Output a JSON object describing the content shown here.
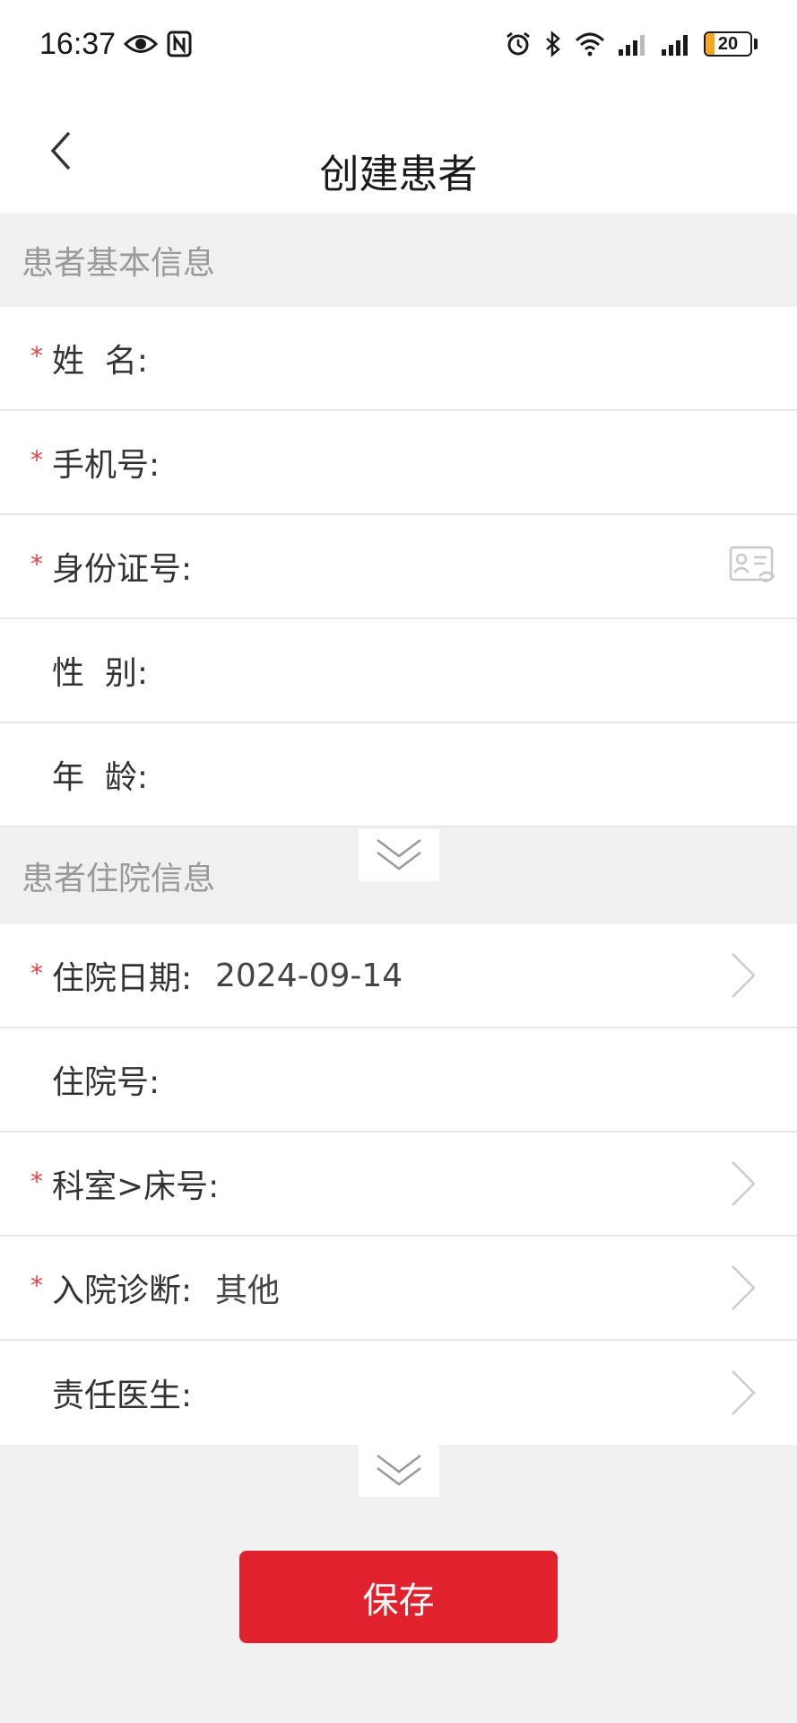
{
  "status_bar": {
    "time": "16:37",
    "battery_level": "20",
    "icons": [
      "eye-icon",
      "nfc-icon",
      "alarm-icon",
      "bluetooth-icon",
      "wifi-icon",
      "signal-icon",
      "signal-icon",
      "battery-icon"
    ]
  },
  "nav": {
    "title": "创建患者",
    "back_icon": "chevron-left-icon"
  },
  "sections": {
    "basic": {
      "title": "患者基本信息",
      "fields": {
        "name": {
          "label": "姓  名:",
          "required_mark": "*",
          "value": ""
        },
        "phone": {
          "label": "手机号:",
          "required_mark": "*",
          "value": ""
        },
        "id_number": {
          "label": "身份证号:",
          "required_mark": "*",
          "value": "",
          "icon": "id-card-scan-icon"
        },
        "gender": {
          "label": "性  别:",
          "value": ""
        },
        "age": {
          "label": "年  龄:",
          "value": ""
        }
      }
    },
    "hospital": {
      "title": "患者住院信息",
      "fields": {
        "admission_date": {
          "label": "住院日期:",
          "required_mark": "*",
          "value": "2024-09-14"
        },
        "admission_no": {
          "label": "住院号:",
          "value": ""
        },
        "dept_bed": {
          "label": "科室>床号:",
          "required_mark": "*",
          "value": ""
        },
        "diagnosis": {
          "label": "入院诊断:",
          "required_mark": "*",
          "value": "其他"
        },
        "doctor": {
          "label": "责任医生:",
          "value": ""
        }
      }
    }
  },
  "actions": {
    "save_label": "保存"
  },
  "colors": {
    "accent": "#e0222e",
    "required": "#e0454a",
    "section_bg": "#f0f0f0",
    "battery": "#f5a623"
  }
}
